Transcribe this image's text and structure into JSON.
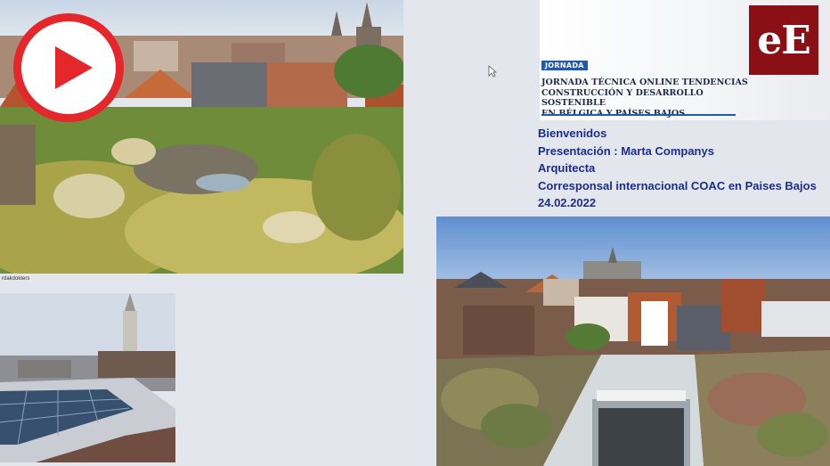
{
  "banner": {
    "logo_text": "eE",
    "badge": "JORNADA",
    "title": "JORNADA TÉCNICA ONLINE TENDENCIAS\nCONSTRUCCIÓN Y DESARROLLO SOSTENIBLE\nEN BÉLGICA Y PAÍSES BAJOS"
  },
  "slide_text": {
    "welcome": "Bienvenidos",
    "presentation": "Presentación : Marta Companys",
    "role": "Arquitecta",
    "correspondent": "Corresponsal internacional COAC en Paises Bajos",
    "date": "24.02.2022"
  },
  "photo_caption": "rdakdokters",
  "icons": {
    "play": "play-icon",
    "logo": "eE-logo",
    "cursor": "mouse-cursor-icon"
  },
  "colors": {
    "play_red": "#e5262a",
    "text_blue": "#1c2d8e",
    "badge_blue": "#1f5bb5",
    "logo_red": "#8b1016"
  }
}
